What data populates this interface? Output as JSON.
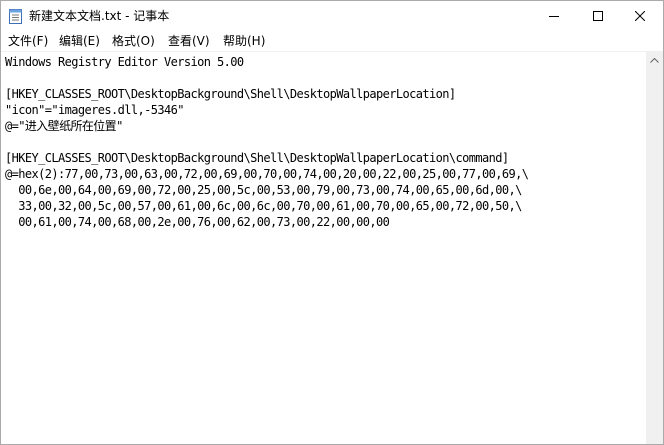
{
  "window": {
    "title": "新建文本文档.txt - 记事本"
  },
  "menu": [
    {
      "label": "文件(F)"
    },
    {
      "label": "编辑(E)"
    },
    {
      "label": "格式(O)"
    },
    {
      "label": "查看(V)"
    },
    {
      "label": "帮助(H)"
    }
  ],
  "editor": {
    "lines": [
      "Windows Registry Editor Version 5.00",
      "",
      "[HKEY_CLASSES_ROOT\\DesktopBackground\\Shell\\DesktopWallpaperLocation]",
      "\"icon\"=\"imageres.dll,-5346\"",
      "@=\"进入壁纸所在位置\"",
      "",
      "[HKEY_CLASSES_ROOT\\DesktopBackground\\Shell\\DesktopWallpaperLocation\\command]",
      "@=hex(2):77,00,73,00,63,00,72,00,69,00,70,00,74,00,20,00,22,00,25,00,77,00,69,\\",
      "  00,6e,00,64,00,69,00,72,00,25,00,5c,00,53,00,79,00,73,00,74,00,65,00,6d,00,\\",
      "  33,00,32,00,5c,00,57,00,61,00,6c,00,6c,00,70,00,61,00,70,00,65,00,72,00,50,\\",
      "  00,61,00,74,00,68,00,2e,00,76,00,62,00,73,00,22,00,00,00"
    ]
  },
  "icons": {
    "app": "notepad-icon",
    "minimize": "minimize-icon",
    "maximize": "maximize-icon",
    "close": "close-icon",
    "scroll_up": "scroll-up-arrow-icon"
  }
}
